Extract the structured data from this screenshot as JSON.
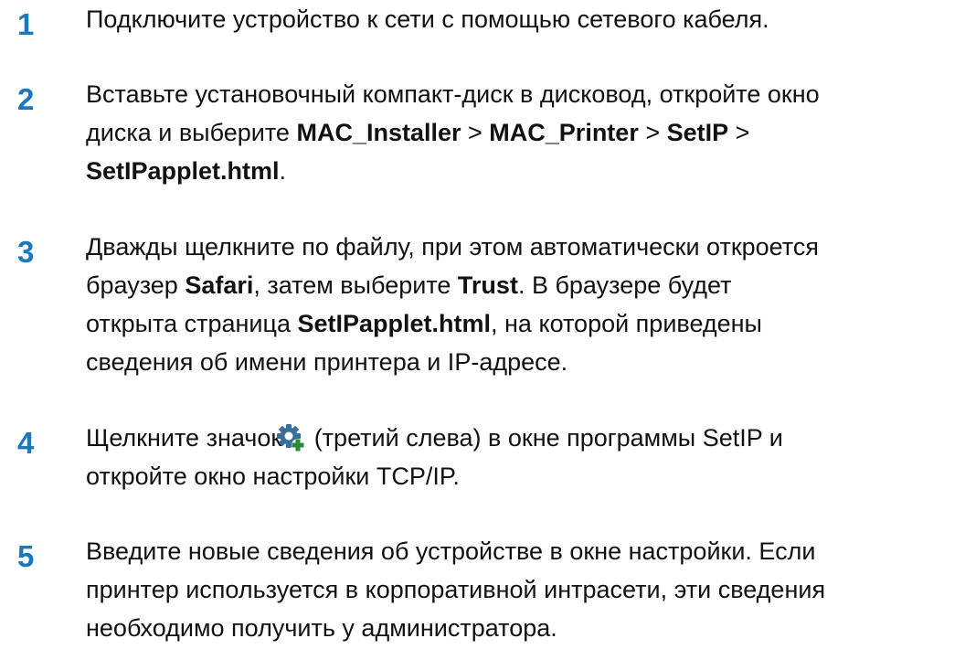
{
  "steps": [
    {
      "number": "1",
      "lines": [
        "Подключите устройство к сети с помощью сетевого кабеля."
      ]
    },
    {
      "number": "2",
      "line1": "Вставьте установочный компакт-диск в дисковод, откройте окно",
      "line2_pre": "диска и выберите ",
      "path_1": "MAC_Installer",
      "sep_1": " > ",
      "path_2": "MAC_Printer",
      "sep_2": " > ",
      "path_3": "SetIP",
      "sep_3": " >",
      "path_4": "SetIPapplet.html",
      "line3_post": "."
    },
    {
      "number": "3",
      "line1": "Дважды щелкните по файлу, при этом автоматически откроется",
      "line2_pre": "браузер ",
      "browser": "Safari",
      "line2_mid": ", затем выберите ",
      "trust": "Trust",
      "line2_post": ". В браузере будет",
      "line3_pre": "открыта страница ",
      "page": "SetIPapplet.html",
      "line3_post": ", на которой приведены",
      "line4": "сведения об имени принтера и IP-адресе."
    },
    {
      "number": "4",
      "line1_pre": "Щелкните значок",
      "icon": "tcp-ip-settings-gear-icon",
      "line1_post": " (третий слева) в окне программы SetIP и",
      "line2": "откройте окно настройки TCP/IP."
    },
    {
      "number": "5",
      "line1": "Введите новые сведения об устройстве в окне настройки. Если",
      "line2": "принтер используется в корпоративной интрасети, эти сведения",
      "line3": "необходимо получить у администратора."
    }
  ],
  "colors": {
    "step_number": "#1a78be",
    "text": "#111111",
    "icon_gear": "#3a6f9a",
    "icon_plus": "#2a8a3a"
  }
}
